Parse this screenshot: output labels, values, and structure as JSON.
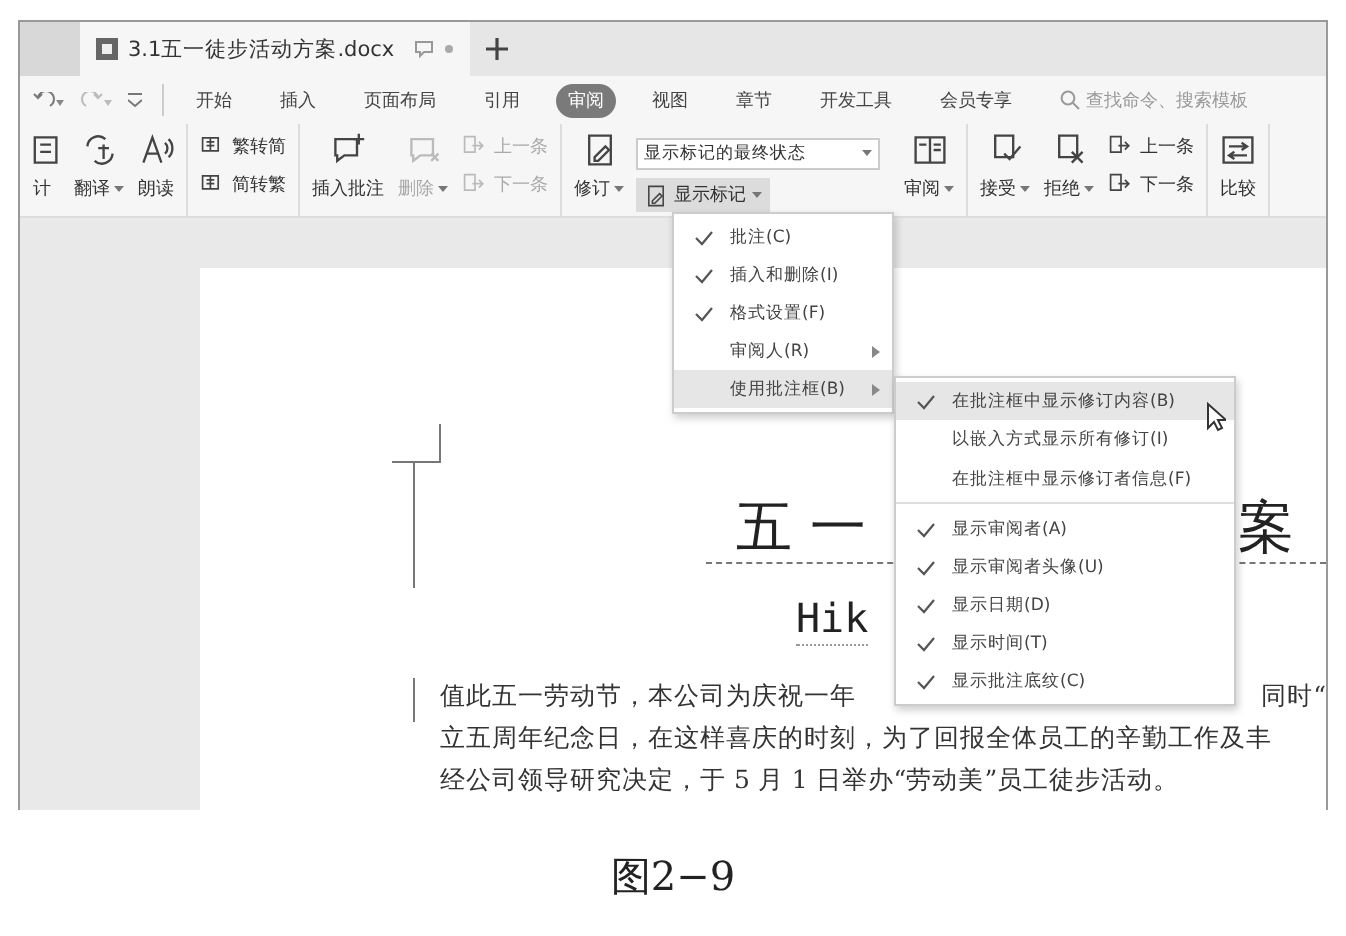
{
  "document_tab": {
    "title": "3.1五一徒步活动方案.docx"
  },
  "quick_access": [
    {
      "kind": "undo"
    },
    {
      "kind": "redo"
    },
    {
      "kind": "customize"
    }
  ],
  "menu_tabs": [
    {
      "label": "开始",
      "selected": false
    },
    {
      "label": "插入",
      "selected": false
    },
    {
      "label": "页面布局",
      "selected": false
    },
    {
      "label": "引用",
      "selected": false
    },
    {
      "label": "审阅",
      "selected": true
    },
    {
      "label": "视图",
      "selected": false
    },
    {
      "label": "章节",
      "selected": false
    },
    {
      "label": "开发工具",
      "selected": false
    },
    {
      "label": "会员专享",
      "selected": false
    }
  ],
  "search": {
    "placeholder": "查找命令、搜索模板"
  },
  "ribbon": [
    {
      "items": [
        {
          "kind": "large",
          "label": "计",
          "dropdown": false,
          "disabled": false
        },
        {
          "kind": "large",
          "label": "翻译",
          "dropdown": true,
          "disabled": false
        },
        {
          "kind": "large",
          "label": "朗读",
          "dropdown": false,
          "disabled": false
        }
      ]
    },
    {
      "items": [
        {
          "kind": "stack",
          "rows": [
            {
              "label": "繁转简",
              "disabled": false
            },
            {
              "label": "简转繁",
              "disabled": false
            }
          ]
        }
      ]
    },
    {
      "items": [
        {
          "kind": "large",
          "label": "插入批注",
          "dropdown": false,
          "disabled": false
        },
        {
          "kind": "large",
          "label": "删除",
          "dropdown": true,
          "disabled": true
        },
        {
          "kind": "stack",
          "rows": [
            {
              "label": "上一条",
              "disabled": true
            },
            {
              "label": "下一条",
              "disabled": true
            }
          ]
        }
      ]
    },
    {
      "items": [
        {
          "kind": "large",
          "label": "修订",
          "dropdown": true,
          "disabled": false
        },
        {
          "kind": "markup",
          "select": "显示标记的最终状态",
          "button": "显示标记",
          "pressed": true
        },
        {
          "kind": "large",
          "label": "审阅",
          "dropdown": true,
          "disabled": false
        }
      ]
    },
    {
      "items": [
        {
          "kind": "large",
          "label": "接受",
          "dropdown": true,
          "disabled": false
        },
        {
          "kind": "large",
          "label": "拒绝",
          "dropdown": true,
          "disabled": false
        },
        {
          "kind": "stack",
          "rows": [
            {
              "label": "上一条",
              "disabled": false
            },
            {
              "label": "下一条",
              "disabled": false
            }
          ]
        }
      ]
    },
    {
      "items": [
        {
          "kind": "large",
          "label": "比较",
          "dropdown": false,
          "disabled": false
        }
      ]
    }
  ],
  "markup_menu": [
    {
      "label": "批注(C)",
      "checked": true,
      "submenu": false,
      "selected": false
    },
    {
      "label": "插入和删除(I)",
      "checked": true,
      "submenu": false,
      "selected": false
    },
    {
      "label": "格式设置(F)",
      "checked": true,
      "submenu": false,
      "selected": false
    },
    {
      "label": "审阅人(R)",
      "checked": false,
      "submenu": true,
      "selected": false
    },
    {
      "label": "使用批注框(B)",
      "checked": false,
      "submenu": true,
      "selected": true
    }
  ],
  "balloon_submenu": [
    {
      "label": "在批注框中显示修订内容(B)",
      "checked": true,
      "selected": true,
      "separator_after": false
    },
    {
      "label": "以嵌入方式显示所有修订(I)",
      "checked": false,
      "selected": false,
      "separator_after": false
    },
    {
      "label": "在批注框中显示修订者信息(F)",
      "checked": false,
      "selected": false,
      "separator_after": true
    },
    {
      "label": "显示审阅者(A)",
      "checked": true,
      "selected": false,
      "separator_after": false
    },
    {
      "label": "显示审阅者头像(U)",
      "checked": true,
      "selected": false,
      "separator_after": false
    },
    {
      "label": "显示日期(D)",
      "checked": true,
      "selected": false,
      "separator_after": false
    },
    {
      "label": "显示时间(T)",
      "checked": true,
      "selected": false,
      "separator_after": false
    },
    {
      "label": "显示批注底纹(C)",
      "checked": true,
      "selected": false,
      "separator_after": false
    }
  ],
  "document": {
    "title_left": "五 一",
    "title_right": "案",
    "subtitle": "Hik",
    "paragraph": [
      {
        "left": "值此五一劳动节，本公司为庆祝一年",
        "right": "同时“"
      },
      {
        "left": "立五周年纪念日，在这样喜庆的时刻，为了回报全体员工的辛勤工作及丰"
      },
      {
        "left": "经公司领导研究决定，于 5 月 1 日举办“劳动美”员工徒步活动。"
      }
    ]
  },
  "caption": "图2−9"
}
